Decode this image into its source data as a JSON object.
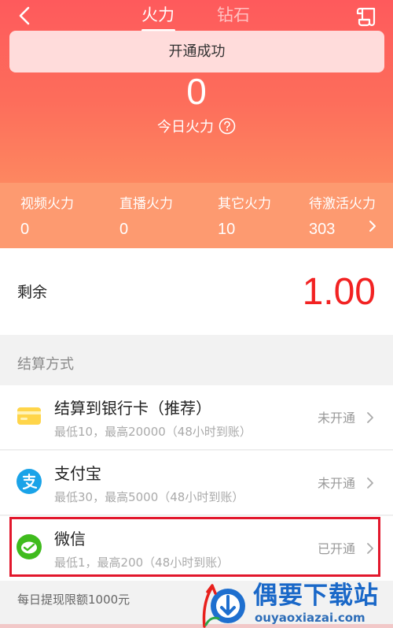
{
  "header": {
    "tabs": [
      {
        "label": "火力",
        "active": true
      },
      {
        "label": "钻石",
        "active": false
      }
    ]
  },
  "toast": {
    "text": "开通成功"
  },
  "today": {
    "value": "0",
    "label": "今日火力"
  },
  "stats": [
    {
      "label": "视频火力",
      "value": "0"
    },
    {
      "label": "直播火力",
      "value": "0"
    },
    {
      "label": "其它火力",
      "value": "10"
    },
    {
      "label": "待激活火力",
      "value": "303"
    }
  ],
  "remaining": {
    "label": "剩余",
    "value": "1.00"
  },
  "settlement": {
    "title": "结算方式",
    "methods": [
      {
        "name": "结算到银行卡（推荐）",
        "desc": "最低10，最高20000（48小时到账）",
        "status": "未开通",
        "icon": "bank-card-icon"
      },
      {
        "name": "支付宝",
        "desc": "最低30，最高5000（48小时到账）",
        "status": "未开通",
        "icon": "alipay-icon"
      },
      {
        "name": "微信",
        "desc": "最低1，最高200（48小时到账）",
        "status": "已开通",
        "icon": "wechat-icon"
      }
    ]
  },
  "daily_limit": "每日提现限额1000元",
  "watermark": {
    "title": "偶要下载站",
    "url": "ouyaoxiazai.com"
  },
  "colors": {
    "primary_red": "#fe5a5c",
    "value_red": "#f22222",
    "stats_orange": "#fd9a70",
    "highlight_border": "#e2172c"
  }
}
